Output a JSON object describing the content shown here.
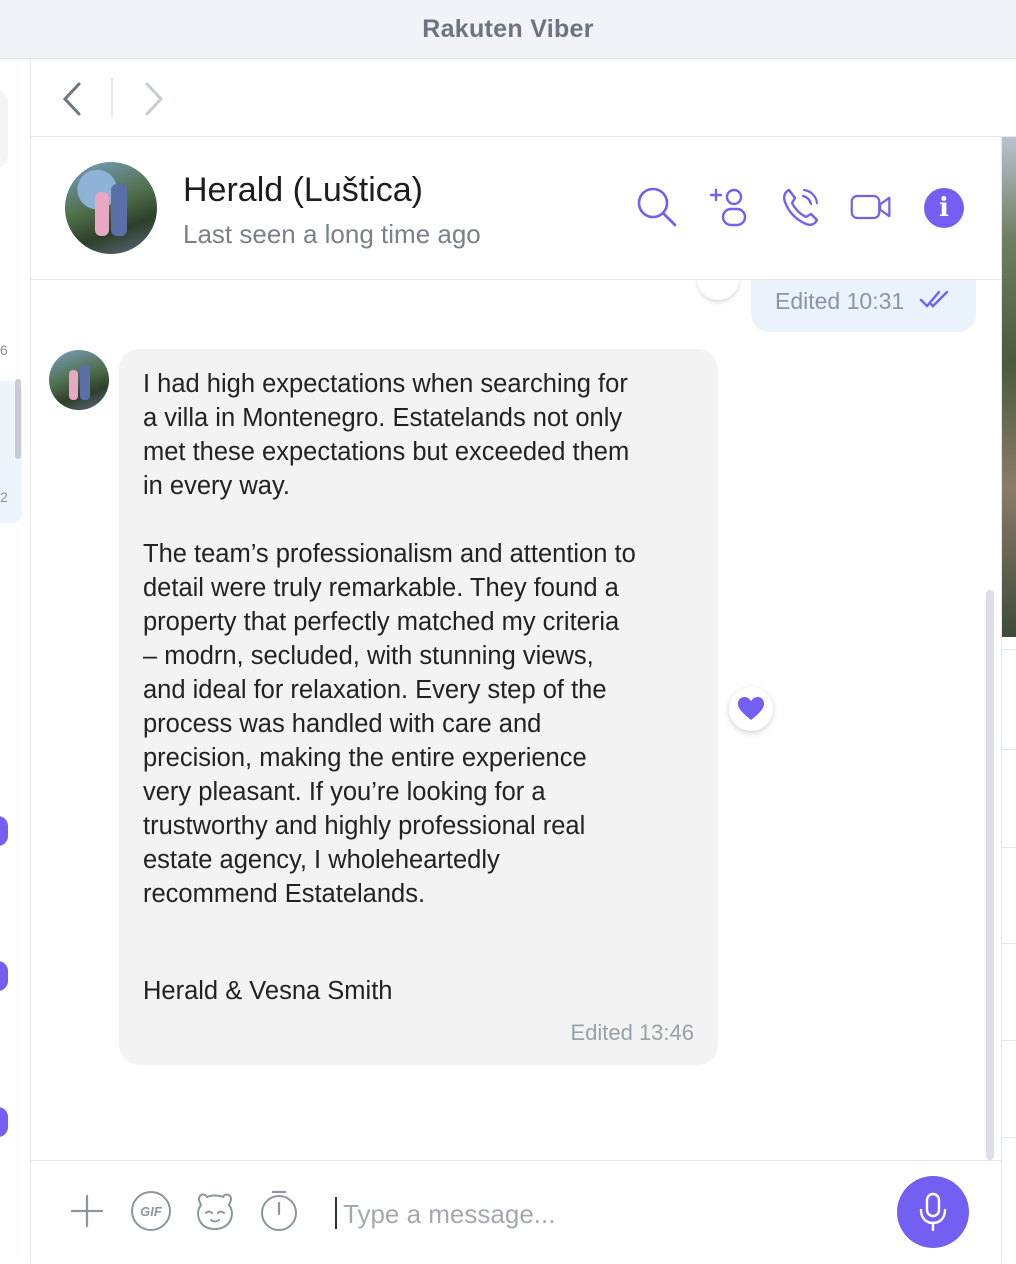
{
  "app": {
    "title": "Rakuten Viber"
  },
  "colors": {
    "accent": "#7360f2",
    "bubble_in": "#f3f3f4",
    "bubble_out": "#eaf2fc"
  },
  "nav": {
    "back_icon": "chevron-left-icon",
    "forward_icon": "chevron-right-icon"
  },
  "contact": {
    "name": "Herald (Luštica)",
    "status": "Last seen a long time ago"
  },
  "header_actions": [
    "search-icon",
    "add-participant-icon",
    "call-icon",
    "video-call-icon",
    "info-icon"
  ],
  "messages": [
    {
      "direction": "outgoing",
      "time": "Edited 10:31",
      "status": "read"
    },
    {
      "direction": "incoming",
      "text": "I had high expectations when searching for\na villa in Montenegro. Estatelands not only\nmet these expectations but exceeded them\nin every way.\n\nThe team’s professionalism and attention to\ndetail were truly remarkable. They found a\nproperty that perfectly matched my criteria\n– modrn, secluded, with stunning views,\nand ideal for relaxation. Every step of the\nprocess was handled with care and\nprecision, making the entire experience\nvery pleasant. If you’re looking for a\ntrustworthy and highly professional real\nestate agency, I wholeheartedly\nrecommend Estatelands.",
      "signature": "Herald & Vesna Smith",
      "time": "Edited 13:46",
      "reaction": "heart-icon"
    }
  ],
  "composer": {
    "placeholder": "Type a message...",
    "value": "",
    "gif_label": "GIF",
    "icons": [
      "plus-icon",
      "gif-icon",
      "sticker-icon",
      "timer-icon",
      "microphone-icon"
    ]
  },
  "sidebar_fragments": [
    "6",
    "2"
  ]
}
